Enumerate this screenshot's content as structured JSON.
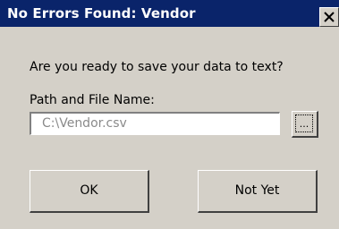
{
  "window": {
    "title": "No Errors Found: Vendor"
  },
  "dialog": {
    "prompt": "Are you ready to save your data to text?",
    "path_label": "Path and File Name:",
    "path_value": "C:\\Vendor.csv",
    "browse_label": "...",
    "ok_label": "OK",
    "not_yet_label": "Not Yet"
  },
  "icons": {
    "close": "close-icon"
  },
  "colors": {
    "titlebar": "#0a246a",
    "face": "#d4d0c8",
    "disabled_text": "#8a8a8a"
  }
}
